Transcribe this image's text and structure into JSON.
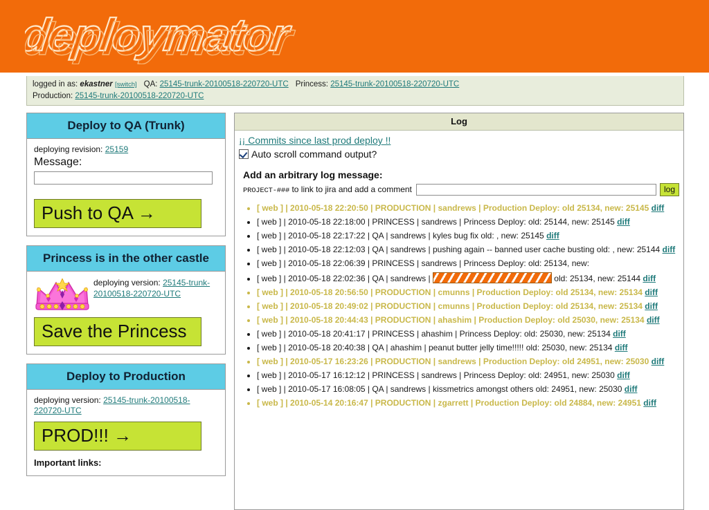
{
  "branding": {
    "logo_text": "deploymator",
    "banner_color": "#F26B0A",
    "accent_blue": "#5DCCE5",
    "accent_green": "#C6E335",
    "link_teal": "#1F7A7A",
    "prod_gold": "#C9B84A"
  },
  "statusbar": {
    "logged_in_label": "logged in as:",
    "username": "ekastner",
    "switch_label": "[switch]",
    "qa_label": "QA:",
    "qa_version": "25145-trunk-20100518-220720-UTC",
    "princess_label": "Princess:",
    "princess_version": "25145-trunk-20100518-220720-UTC",
    "production_label": "Production:",
    "production_version": "25145-trunk-20100518-220720-UTC"
  },
  "panels": {
    "qa": {
      "title": "Deploy to QA (Trunk)",
      "deploy_label": "deploying revision:",
      "revision": "25159",
      "message_label": "Message:",
      "message_value": "",
      "message_placeholder": "",
      "button_label": "Push to QA →"
    },
    "princess": {
      "title": "Princess is in the other castle",
      "deploy_label": "deploying version:",
      "version": "25145-trunk-20100518-220720-UTC",
      "button_label": "Save the Princess",
      "icon": "crown-icon"
    },
    "production": {
      "title": "Deploy to Production",
      "deploy_label": "deploying version:",
      "version": "25145-trunk-20100518-220720-UTC",
      "button_label": "PROD!!! →",
      "important_links_label": "Important links:"
    }
  },
  "log": {
    "title": "Log",
    "commits_link": "¡¡ Commits since last prod deploy !!",
    "autoscroll_label": "Auto scroll command output?",
    "autoscroll_checked": true,
    "add_message_title": "Add an arbitrary log message:",
    "jira_hint_code": "PROJECT-###",
    "jira_hint_text": " to link to jira and add a comment",
    "jira_input_value": "",
    "jira_input_placeholder": "",
    "log_button_label": "log",
    "diff_label": "diff",
    "entries": [
      {
        "source": "[ web ]",
        "timestamp": "2010-05-18 22:20:50",
        "env": "PRODUCTION",
        "user": "sandrews",
        "message": "Production Deploy: old 25134, new: 25145",
        "diff": "diff",
        "production": true,
        "redacted": false,
        "text": "[ web ] | 2010-05-18 22:20:50 | PRODUCTION | sandrews | Production Deploy: old 25134, new: 25145"
      },
      {
        "source": "[ web ]",
        "timestamp": "2010-05-18 22:18:00",
        "env": "PRINCESS",
        "user": "sandrews",
        "message": "Princess Deploy: old: 25144, new: 25145",
        "diff": "diff",
        "production": false,
        "redacted": false,
        "text": "[ web ] | 2010-05-18 22:18:00 | PRINCESS | sandrews | Princess Deploy: old: 25144, new: 25145"
      },
      {
        "source": "[ web ]",
        "timestamp": "2010-05-18 22:17:22",
        "env": "QA",
        "user": "sandrews",
        "message": "kyles bug fix old: , new: 25145",
        "diff": "diff",
        "production": false,
        "redacted": false,
        "text": "[ web ] | 2010-05-18 22:17:22 | QA | sandrews | kyles bug fix old: , new: 25145"
      },
      {
        "source": "[ web ]",
        "timestamp": "2010-05-18 22:12:03",
        "env": "QA",
        "user": "sandrews",
        "message": "pushing again -- banned user cache busting old: , new: 25144",
        "diff": "diff",
        "production": false,
        "redacted": false,
        "text": "[ web ] | 2010-05-18 22:12:03 | QA | sandrews | pushing again -- banned user cache busting old: , new: 25144"
      },
      {
        "source": "[ web ]",
        "timestamp": "2010-05-18 22:06:39",
        "env": "PRINCESS",
        "user": "sandrews",
        "message": "Princess Deploy: old: 25134, new:",
        "diff": "",
        "production": false,
        "redacted": false,
        "text": "[ web ] | 2010-05-18 22:06:39 | PRINCESS | sandrews | Princess Deploy: old: 25134, new:"
      },
      {
        "source": "[ web ]",
        "timestamp": "2010-05-18 22:02:36",
        "env": "QA",
        "user": "sandrews",
        "message_before": "[ web ] | 2010-05-18 22:02:36 | QA | sandrews | ",
        "message_after": " old: 25134, new: 25144",
        "diff": "diff",
        "production": false,
        "redacted": true,
        "text": "[ web ] | 2010-05-18 22:02:36 | QA | sandrews | [REDACTED] old: 25134, new: 25144"
      },
      {
        "source": "[ web ]",
        "timestamp": "2010-05-18 20:56:50",
        "env": "PRODUCTION",
        "user": "cmunns",
        "message": "Production Deploy: old 25134, new: 25134",
        "diff": "diff",
        "production": true,
        "redacted": false,
        "text": "[ web ] | 2010-05-18 20:56:50 | PRODUCTION | cmunns | Production Deploy: old 25134, new: 25134"
      },
      {
        "source": "[ web ]",
        "timestamp": "2010-05-18 20:49:02",
        "env": "PRODUCTION",
        "user": "cmunns",
        "message": "Production Deploy: old 25134, new: 25134",
        "diff": "diff",
        "production": true,
        "redacted": false,
        "text": "[ web ] | 2010-05-18 20:49:02 | PRODUCTION | cmunns | Production Deploy: old 25134, new: 25134"
      },
      {
        "source": "[ web ]",
        "timestamp": "2010-05-18 20:44:43",
        "env": "PRODUCTION",
        "user": "ahashim",
        "message": "Production Deploy: old 25030, new: 25134",
        "diff": "diff",
        "production": true,
        "redacted": false,
        "text": "[ web ] | 2010-05-18 20:44:43 | PRODUCTION | ahashim | Production Deploy: old 25030, new: 25134"
      },
      {
        "source": "[ web ]",
        "timestamp": "2010-05-18 20:41:17",
        "env": "PRINCESS",
        "user": "ahashim",
        "message": "Princess Deploy: old: 25030, new: 25134",
        "diff": "diff",
        "production": false,
        "redacted": false,
        "text": "[ web ] | 2010-05-18 20:41:17 | PRINCESS | ahashim | Princess Deploy: old: 25030, new: 25134"
      },
      {
        "source": "[ web ]",
        "timestamp": "2010-05-18 20:40:38",
        "env": "QA",
        "user": "ahashim",
        "message": "peanut butter jelly time!!!!! old: 25030, new: 25134",
        "diff": "diff",
        "production": false,
        "redacted": false,
        "text": "[ web ] | 2010-05-18 20:40:38 | QA | ahashim | peanut butter jelly time!!!!! old: 25030, new: 25134"
      },
      {
        "source": "[ web ]",
        "timestamp": "2010-05-17 16:23:26",
        "env": "PRODUCTION",
        "user": "sandrews",
        "message": "Production Deploy: old 24951, new: 25030",
        "diff": "diff",
        "production": true,
        "redacted": false,
        "text": "[ web ] | 2010-05-17 16:23:26 | PRODUCTION | sandrews | Production Deploy: old 24951, new: 25030"
      },
      {
        "source": "[ web ]",
        "timestamp": "2010-05-17 16:12:12",
        "env": "PRINCESS",
        "user": "sandrews",
        "message": "Princess Deploy: old: 24951, new: 25030",
        "diff": "diff",
        "production": false,
        "redacted": false,
        "text": "[ web ] | 2010-05-17 16:12:12 | PRINCESS | sandrews | Princess Deploy: old: 24951, new: 25030"
      },
      {
        "source": "[ web ]",
        "timestamp": "2010-05-17 16:08:05",
        "env": "QA",
        "user": "sandrews",
        "message": "kissmetrics amongst others old: 24951, new: 25030",
        "diff": "diff",
        "production": false,
        "redacted": false,
        "text": "[ web ] | 2010-05-17 16:08:05 | QA | sandrews | kissmetrics amongst others old: 24951, new: 25030"
      },
      {
        "source": "[ web ]",
        "timestamp": "2010-05-14 20:16:47",
        "env": "PRODUCTION",
        "user": "zgarrett",
        "message": "Production Deploy: old 24884, new: 24951",
        "diff": "diff",
        "production": true,
        "redacted": false,
        "text": "[ web ] | 2010-05-14 20:16:47 | PRODUCTION | zgarrett | Production Deploy: old 24884, new: 24951"
      }
    ]
  }
}
